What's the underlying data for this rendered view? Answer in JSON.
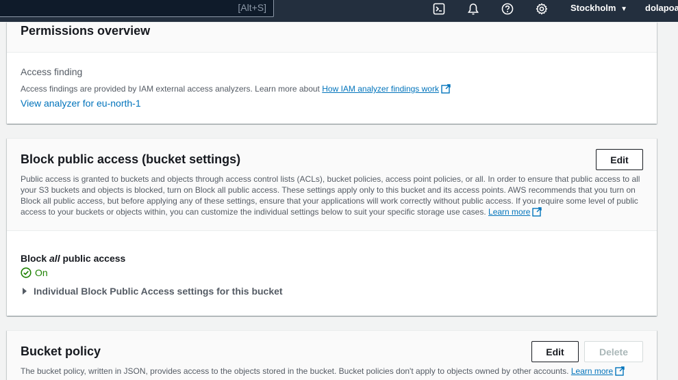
{
  "topnav": {
    "search_shortcut": "[Alt+S]",
    "icons": [
      "cloudshell-icon",
      "bell-icon",
      "help-icon",
      "gear-icon"
    ],
    "region": "Stockholm",
    "region_caret": "▼",
    "user": "dolapoaj"
  },
  "permissions": {
    "title": "Permissions overview",
    "access_finding_label": "Access finding",
    "access_finding_desc": "Access findings are provided by IAM external access analyzers. Learn more about ",
    "analyzer_link": "How IAM analyzer findings work",
    "view_analyzer_link": "View analyzer for eu-north-1"
  },
  "block_public_access": {
    "title": "Block public access (bucket settings)",
    "edit_label": "Edit",
    "description": "Public access is granted to buckets and objects through access control lists (ACLs), bucket policies, access point policies, or all. In order to ensure that public access to all your S3 buckets and objects is blocked, turn on Block all public access. These settings apply only to this bucket and its access points. AWS recommends that you turn on Block all public access, but before applying any of these settings, ensure that your applications will work correctly without public access. If you require some level of public access to your buckets or objects within, you can customize the individual settings below to suit your specific storage use cases.",
    "learn_more": "Learn more",
    "block_all_prefix": "Block ",
    "block_all_em": "all",
    "block_all_suffix": " public access",
    "status": "On",
    "status_color": "#1d8102",
    "individual_settings": "Individual Block Public Access settings for this bucket"
  },
  "bucket_policy": {
    "title": "Bucket policy",
    "edit_label": "Edit",
    "delete_label": "Delete",
    "description": "The bucket policy, written in JSON, provides access to the objects stored in the bucket. Bucket policies don't apply to objects owned by other accounts.",
    "learn_more": "Learn more"
  }
}
